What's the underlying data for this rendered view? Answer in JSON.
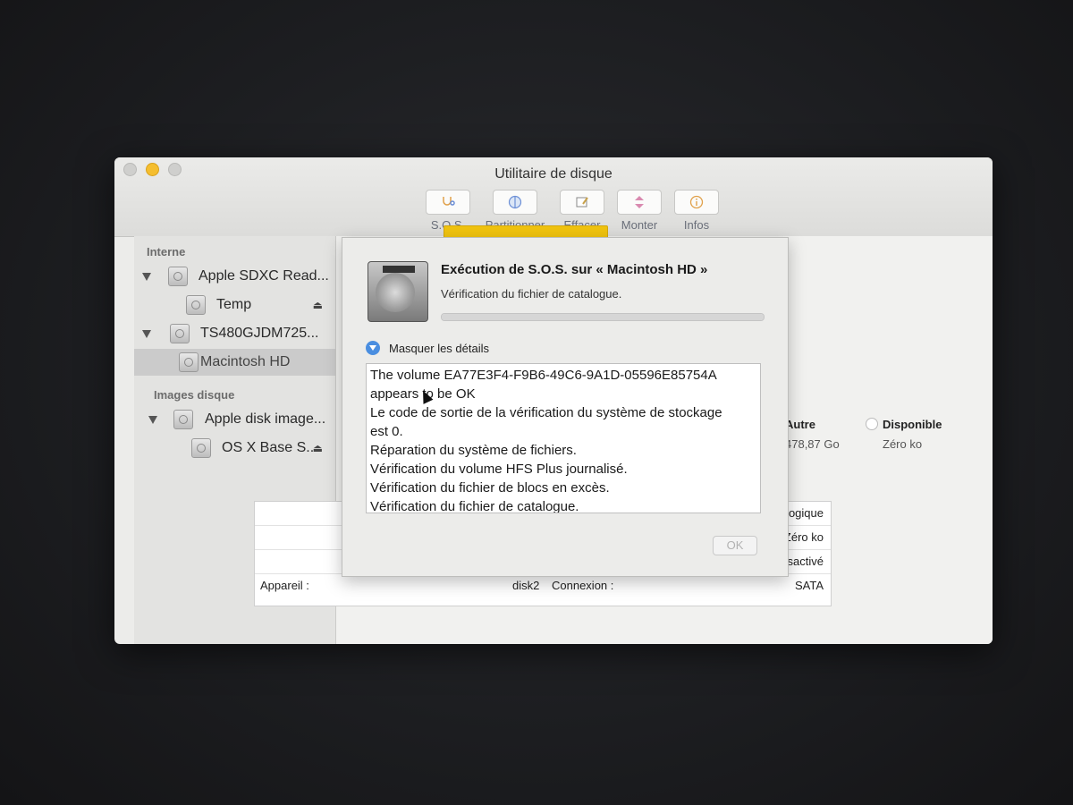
{
  "window": {
    "title": "Utilitaire de disque"
  },
  "toolbar": {
    "items": [
      {
        "label": "S.O.S."
      },
      {
        "label": "Partitionner"
      },
      {
        "label": "Effacer"
      },
      {
        "label": "Monter"
      },
      {
        "label": "Infos"
      }
    ]
  },
  "sidebar": {
    "section_internal": "Interne",
    "section_images": "Images disque",
    "items": [
      {
        "label": "Apple SDXC Read..."
      },
      {
        "label": "Temp"
      },
      {
        "label": "TS480GJDM725..."
      },
      {
        "label": "Macintosh HD"
      },
      {
        "label": "Apple disk image..."
      },
      {
        "label": "OS X Base S..."
      }
    ]
  },
  "content": {
    "legend": [
      {
        "label": "Autre",
        "value": "478,87 Go"
      },
      {
        "label": "Disponible",
        "value": "Zéro ko"
      }
    ],
    "info_rows": [
      {
        "value": "Volume logique"
      },
      {
        "value": "Zéro ko"
      },
      {
        "value": "Désactivé"
      },
      {
        "key": "Appareil :",
        "value": "disk2",
        "key2": "Connexion :",
        "value2": "SATA"
      }
    ]
  },
  "sheet": {
    "title": "Exécution de S.O.S. sur « Macintosh HD »",
    "status": "Vérification du fichier de catalogue.",
    "details_toggle": "Masquer les détails",
    "log_lines": [
      "The volume EA77E3F4-F9B6-49C6-9A1D-05596E85754A",
      "appears to be OK",
      "Le code de sortie de la vérification du système de stockage",
      "est 0.",
      "Réparation du système de fichiers.",
      "Vérification du volume HFS Plus journalisé.",
      "Vérification du fichier de blocs en excès.",
      "Vérification du fichier de catalogue."
    ],
    "ok_label": "OK"
  },
  "colors": {
    "usage_bar": "#f1c40f",
    "disclosure": "#4a8ee0",
    "minimize": "#f5be2f"
  }
}
